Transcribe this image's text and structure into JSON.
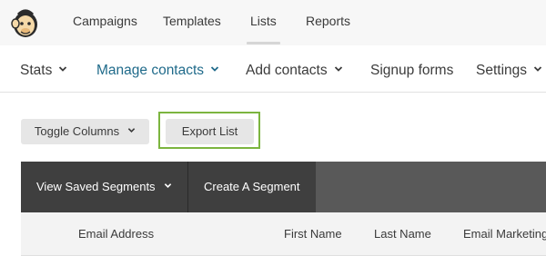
{
  "top_nav": {
    "items": [
      {
        "label": "Campaigns"
      },
      {
        "label": "Templates"
      },
      {
        "label": "Lists"
      },
      {
        "label": "Reports"
      }
    ]
  },
  "sub_nav": {
    "items": [
      {
        "label": "Stats"
      },
      {
        "label": "Manage contacts"
      },
      {
        "label": "Add contacts"
      },
      {
        "label": "Signup forms"
      },
      {
        "label": "Settings"
      }
    ]
  },
  "toolbar": {
    "toggle_columns_label": "Toggle Columns",
    "export_list_label": "Export List"
  },
  "segments": {
    "view_saved_label": "View Saved Segments",
    "create_label": "Create A Segment"
  },
  "table": {
    "columns": [
      "Email Address",
      "First Name",
      "Last Name",
      "Email Marketing"
    ]
  },
  "colors": {
    "accent_link": "#1f6a8a",
    "highlight": "#7cb53f",
    "dark_bar": "#3f3f3f"
  }
}
